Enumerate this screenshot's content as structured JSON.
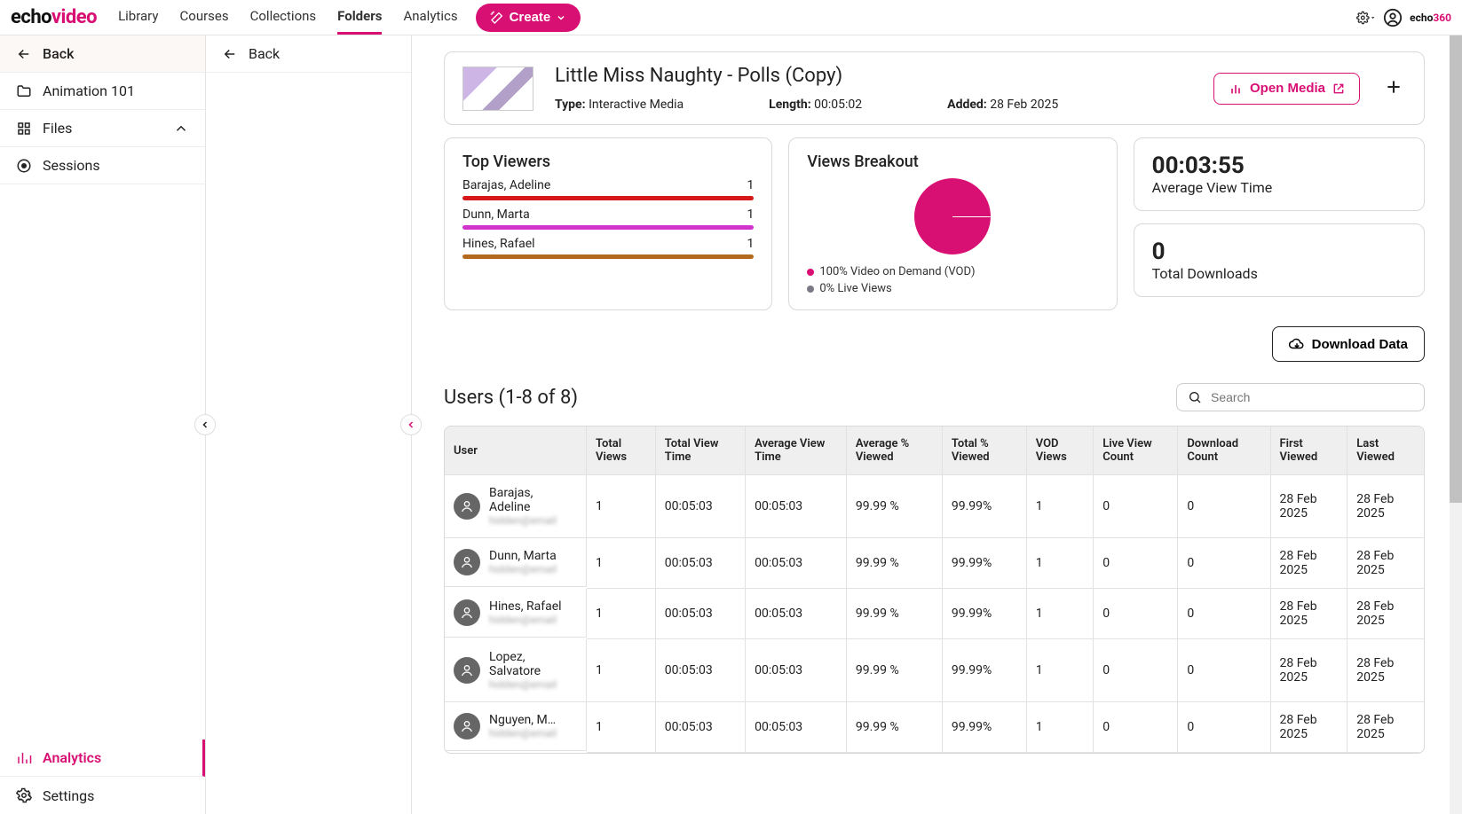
{
  "logo": {
    "part1": "echo",
    "part2": "video"
  },
  "small_logo": {
    "part1": "echo",
    "part2": "360"
  },
  "topnav": {
    "items": [
      "Library",
      "Courses",
      "Collections",
      "Folders",
      "Analytics"
    ],
    "active_index": 3,
    "create_label": "Create"
  },
  "sidebar": {
    "back_label": "Back",
    "items": [
      {
        "icon": "folder",
        "label": "Animation 101"
      },
      {
        "icon": "files",
        "label": "Files",
        "expandable": true
      },
      {
        "icon": "sessions",
        "label": "Sessions"
      }
    ],
    "footer": [
      {
        "icon": "analytics",
        "label": "Analytics",
        "active": true
      },
      {
        "icon": "settings",
        "label": "Settings"
      }
    ]
  },
  "inner": {
    "back_label": "Back"
  },
  "media": {
    "title": "Little Miss Naughty - Polls (Copy)",
    "type_label": "Type:",
    "type_value": "Interactive Media",
    "length_label": "Length:",
    "length_value": "00:05:02",
    "added_label": "Added:",
    "added_value": "28 Feb 2025",
    "open_label": "Open Media"
  },
  "top_viewers": {
    "title": "Top Viewers",
    "items": [
      {
        "name": "Barajas, Adeline",
        "count": "1",
        "color": "#d61818"
      },
      {
        "name": "Dunn, Marta",
        "count": "1",
        "color": "#d233cc"
      },
      {
        "name": "Hines, Rafael",
        "count": "1",
        "color": "#b46a1d"
      }
    ]
  },
  "views_breakout": {
    "title": "Views Breakout",
    "legend": [
      {
        "text": "100% Video on Demand (VOD)",
        "color": "#d91073"
      },
      {
        "text": "0% Live Views",
        "color": "#7a7a86"
      }
    ]
  },
  "stats": {
    "avg_view_time_value": "00:03:55",
    "avg_view_time_label": "Average View Time",
    "downloads_value": "0",
    "downloads_label": "Total Downloads"
  },
  "download_data_label": "Download Data",
  "users": {
    "header": "Users (1-8 of 8)",
    "search_placeholder": "Search",
    "columns": [
      "User",
      "Total Views",
      "Total View Time",
      "Average View Time",
      "Average % Viewed",
      "Total % Viewed",
      "VOD Views",
      "Live View Count",
      "Download Count",
      "First Viewed",
      "Last Viewed"
    ],
    "rows": [
      {
        "name": "Barajas, Adeline",
        "total_views": "1",
        "total_time": "00:05:03",
        "avg_time": "00:05:03",
        "avg_pct": "99.99 %",
        "tot_pct": "99.99%",
        "vod": "1",
        "live": "0",
        "dl": "0",
        "first": "28 Feb 2025",
        "last": "28 Feb 2025"
      },
      {
        "name": "Dunn, Marta",
        "total_views": "1",
        "total_time": "00:05:03",
        "avg_time": "00:05:03",
        "avg_pct": "99.99 %",
        "tot_pct": "99.99%",
        "vod": "1",
        "live": "0",
        "dl": "0",
        "first": "28 Feb 2025",
        "last": "28 Feb 2025"
      },
      {
        "name": "Hines, Rafael",
        "total_views": "1",
        "total_time": "00:05:03",
        "avg_time": "00:05:03",
        "avg_pct": "99.99 %",
        "tot_pct": "99.99%",
        "vod": "1",
        "live": "0",
        "dl": "0",
        "first": "28 Feb 2025",
        "last": "28 Feb 2025"
      },
      {
        "name": "Lopez, Salvatore",
        "total_views": "1",
        "total_time": "00:05:03",
        "avg_time": "00:05:03",
        "avg_pct": "99.99 %",
        "tot_pct": "99.99%",
        "vod": "1",
        "live": "0",
        "dl": "0",
        "first": "28 Feb 2025",
        "last": "28 Feb 2025"
      },
      {
        "name": "Nguyen, M…",
        "total_views": "1",
        "total_time": "00:05:03",
        "avg_time": "00:05:03",
        "avg_pct": "99.99 %",
        "tot_pct": "99.99%",
        "vod": "1",
        "live": "0",
        "dl": "0",
        "first": "28 Feb 2025",
        "last": "28 Feb 2025"
      }
    ]
  },
  "chart_data": {
    "type": "pie",
    "title": "Views Breakout",
    "series": [
      {
        "name": "Video on Demand (VOD)",
        "value": 100
      },
      {
        "name": "Live Views",
        "value": 0
      }
    ]
  }
}
